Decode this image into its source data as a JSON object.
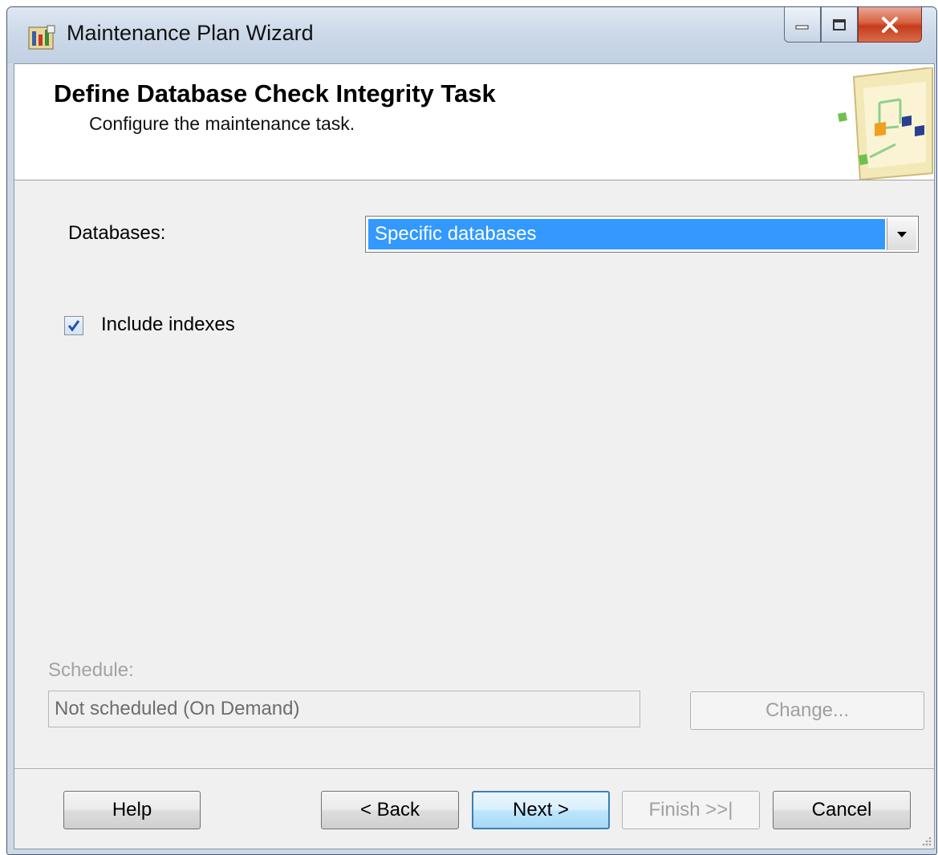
{
  "window": {
    "title": "Maintenance Plan Wizard",
    "icon": "maintenance-plan-wizard-icon",
    "caption_buttons": [
      "minimize-icon",
      "maximize-icon",
      "close-icon"
    ]
  },
  "header": {
    "title": "Define Database Check Integrity Task",
    "subtitle": "Configure the maintenance task.",
    "graphic": "wizard-graphic-icon"
  },
  "form": {
    "databases_label": "Databases:",
    "databases_value": "Specific databases",
    "include_indexes_label": "Include indexes",
    "include_indexes_checked": true,
    "schedule_label": "Schedule:",
    "schedule_value": "Not scheduled (On Demand)",
    "change_label": "Change..."
  },
  "footer": {
    "help_label": "Help",
    "back_label": "< Back",
    "next_label": "Next >",
    "finish_label": "Finish >>|",
    "cancel_label": "Cancel"
  },
  "colors": {
    "selection": "#3399ff",
    "client_background": "#f0f0f0",
    "disabled_text": "#a3a3a3",
    "close_button": "#c43b1c"
  }
}
